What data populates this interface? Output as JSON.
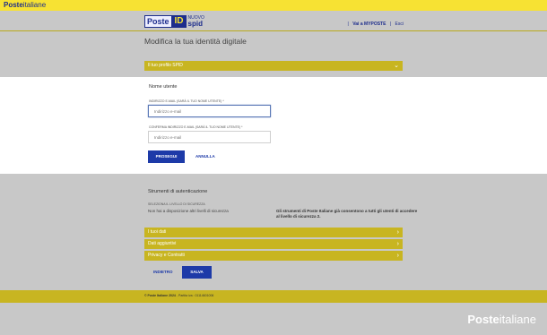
{
  "topbar": {
    "brand_bold": "Poste",
    "brand_rest": "italiane"
  },
  "header": {
    "logo_poste": "Poste",
    "logo_id": "ID",
    "logo_nuovo": "NUOVO",
    "logo_spid": "spid",
    "sep1": "|",
    "myposte": "Vai a MYPOSTE",
    "sep2": "|",
    "exit": "Esci"
  },
  "page": {
    "title": "Modifica la tua identità digitale"
  },
  "profile_accordion": {
    "label": "Il tuo profilo SPID"
  },
  "username_section": {
    "title": "Nome utente",
    "email_label": "Indirizzo e-mail (sarà il tuo nome utente) *",
    "email_placeholder": "Indirizzo e-mail",
    "confirm_label": "Conferma indirizzo e-mail (sarà il tuo nome utente) *",
    "confirm_placeholder": "Indirizzo e-mail",
    "continue_button": "Prosegui",
    "cancel_link": "Annulla"
  },
  "auth_section": {
    "title": "Strumenti di autenticazione",
    "level_label": "Seleziona il livello di sicurezza",
    "level_value": "Non hai a disposizione altri livelli di sicurezza",
    "note": "Gli strumenti di Poste Italiane già consentono a tutti gli utenti di accedere al livello di sicurezza 2."
  },
  "accordions": [
    {
      "label": "I tuoi dati"
    },
    {
      "label": "Dati aggiuntivi"
    },
    {
      "label": "Privacy e Contratti"
    }
  ],
  "actions": {
    "back": "Indietro",
    "save": "Salva"
  },
  "footer": {
    "copyright_bold": "© Poste Italiane 2024",
    "copyright_rest": " - Partita iva : 01114601006"
  },
  "bottom_brand": {
    "bold": "Poste",
    "rest": "italiane"
  },
  "colors": {
    "yellow": "#f7e233",
    "olive": "#c8b521",
    "blue": "#1d3aa8"
  },
  "icons": {
    "chevron_down": "chevron-down-icon",
    "chevron_right": "chevron-right-icon"
  }
}
